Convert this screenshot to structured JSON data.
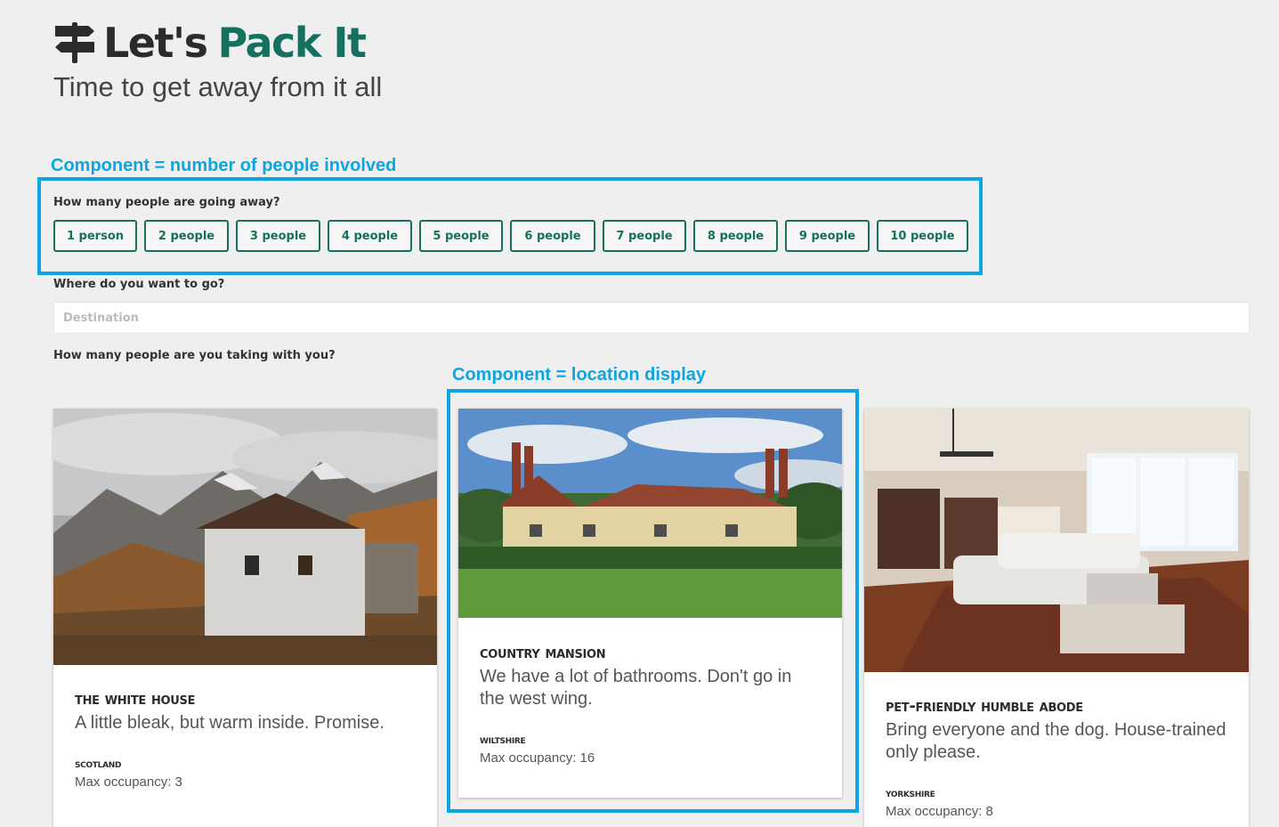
{
  "header": {
    "logo_word1": "Let's",
    "logo_word2": "Pack It",
    "tagline": "Time to get away from it all"
  },
  "annotations": {
    "people_component": "Component = number of people involved",
    "location_component": "Component = location display"
  },
  "form": {
    "people_question": "How many people are going away?",
    "people_options": [
      "1 person",
      "2 people",
      "3 people",
      "4 people",
      "5 people",
      "6 people",
      "7 people",
      "8 people",
      "9 people",
      "10 people"
    ],
    "destination_question": "Where do you want to go?",
    "destination_placeholder": "Destination",
    "taking_question": "How many people are you taking with you?"
  },
  "locations": [
    {
      "title": "The White House",
      "description": "A little bleak, but warm inside. Promise.",
      "region": "Scotland",
      "occupancy": "Max occupancy: 3"
    },
    {
      "title": "Country Mansion",
      "description": "We have a lot of bathrooms. Don't go in the west wing.",
      "region": "Wiltshire",
      "occupancy": "Max occupancy: 16"
    },
    {
      "title": "Pet-friendly humble abode",
      "description": "Bring everyone and the dog. House-trained only please.",
      "region": "Yorkshire",
      "occupancy": "Max occupancy: 8"
    }
  ],
  "colors": {
    "accent": "#16705f",
    "annotation": "#0ea5e0",
    "background": "#efefef"
  }
}
